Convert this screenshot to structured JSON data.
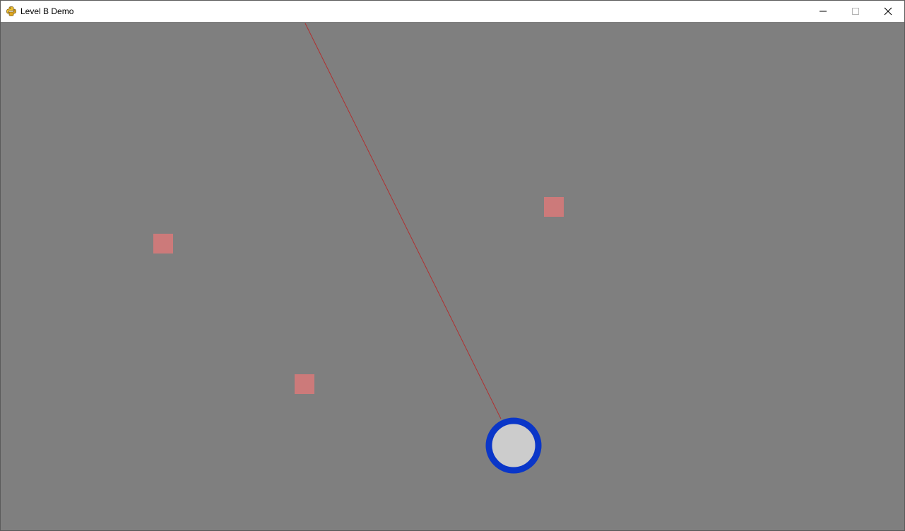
{
  "window": {
    "title": "Level B Demo",
    "app_icon": "pygame-snake-icon",
    "controls": [
      "minimize-icon",
      "maximize-icon",
      "close-icon"
    ]
  },
  "scene": {
    "background_color": "#7f7f7f",
    "aim_line_color": "#b03030",
    "target_color": "#cc7a7a",
    "player_ring_color": "#0a36c8",
    "player_fill_color": "#cccccc",
    "target_count": 3
  }
}
